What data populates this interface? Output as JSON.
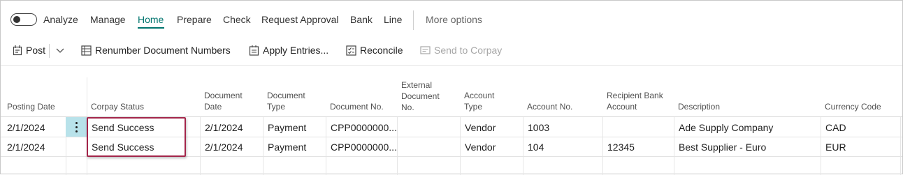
{
  "nav": {
    "items": [
      "Analyze",
      "Manage",
      "Home",
      "Prepare",
      "Check",
      "Request Approval",
      "Bank",
      "Line"
    ],
    "active": "Home",
    "more_options": "More options"
  },
  "toolbar": {
    "post": "Post",
    "renumber": "Renumber Document Numbers",
    "apply_entries": "Apply Entries...",
    "reconcile": "Reconcile",
    "send_to_corpay": "Send to Corpay"
  },
  "table": {
    "headers": {
      "posting_date": "Posting Date",
      "corpay_status": "Corpay Status",
      "document_date": "Document\nDate",
      "document_type": "Document\nType",
      "document_no": "Document No.",
      "external_document_no": "External\nDocument\nNo.",
      "account_type": "Account\nType",
      "account_no": "Account No.",
      "recipient_bank_account": "Recipient Bank\nAccount",
      "description": "Description",
      "currency_code": "Currency Code"
    },
    "rows": [
      {
        "posting_date": "2/1/2024",
        "corpay_status": "Send Success",
        "document_date": "2/1/2024",
        "document_type": "Payment",
        "document_no": "CPP0000000...",
        "external_document_no": "",
        "account_type": "Vendor",
        "account_no": "1003",
        "recipient_bank_account": "",
        "description": "Ade Supply Company",
        "currency_code": "CAD"
      },
      {
        "posting_date": "2/1/2024",
        "corpay_status": "Send Success",
        "document_date": "2/1/2024",
        "document_type": "Payment",
        "document_no": "CPP0000000...",
        "external_document_no": "",
        "account_type": "Vendor",
        "account_no": "104",
        "recipient_bank_account": "12345",
        "description": "Best Supplier - Euro",
        "currency_code": "EUR"
      }
    ]
  },
  "colors": {
    "accent": "#00746e",
    "highlight_border": "#a3254a",
    "menu_cell": "#b8e2ea"
  }
}
